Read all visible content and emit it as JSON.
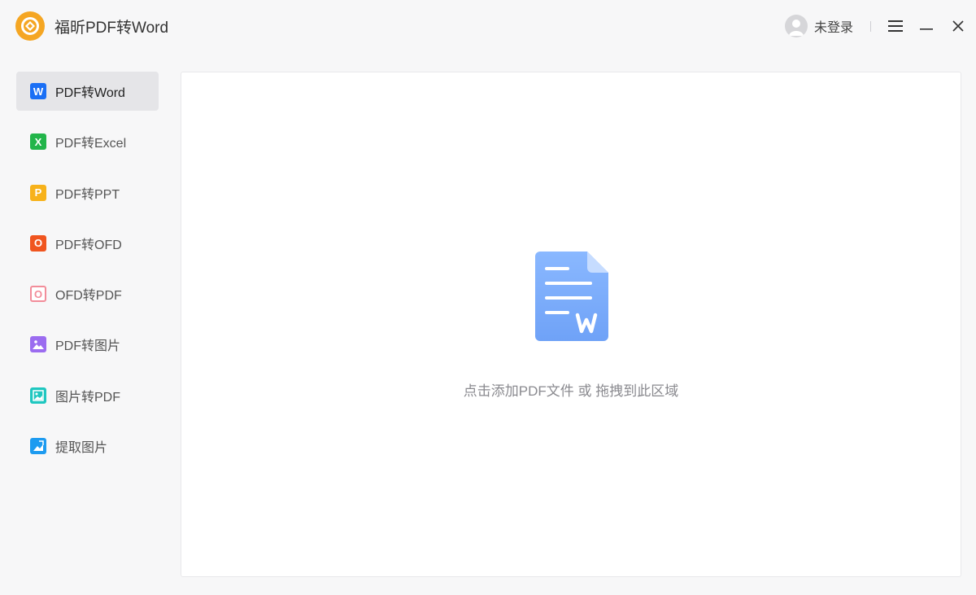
{
  "app": {
    "title": "福昕PDF转Word"
  },
  "user": {
    "status": "未登录"
  },
  "sidebar": {
    "items": [
      {
        "label": "PDF转Word",
        "icon": "word-icon",
        "glyph": "W",
        "color": "#1a6ff5",
        "active": true
      },
      {
        "label": "PDF转Excel",
        "icon": "excel-icon",
        "glyph": "X",
        "color": "#22b54a",
        "active": false
      },
      {
        "label": "PDF转PPT",
        "icon": "ppt-icon",
        "glyph": "P",
        "color": "#f7b21b",
        "active": false
      },
      {
        "label": "PDF转OFD",
        "icon": "ofd-icon",
        "glyph": "O",
        "color": "#f0551f",
        "active": false
      },
      {
        "label": "OFD转PDF",
        "icon": "ofd-to-pdf-icon",
        "glyph": "O",
        "color": "#f28d9a",
        "active": false
      },
      {
        "label": "PDF转图片",
        "icon": "pdf-to-image-icon",
        "glyph": "",
        "color": "#9b6cf0",
        "active": false
      },
      {
        "label": "图片转PDF",
        "icon": "image-to-pdf-icon",
        "glyph": "",
        "color": "#1fc7c0",
        "active": false
      },
      {
        "label": "提取图片",
        "icon": "extract-image-icon",
        "glyph": "",
        "color": "#1d9bf0",
        "active": false
      }
    ]
  },
  "dropzone": {
    "hint": "点击添加PDF文件 或 拖拽到此区域"
  },
  "colors": {
    "accent": "#1a6ff5",
    "doc_icon": "#7fb0ff",
    "logo": "#f5a623"
  }
}
